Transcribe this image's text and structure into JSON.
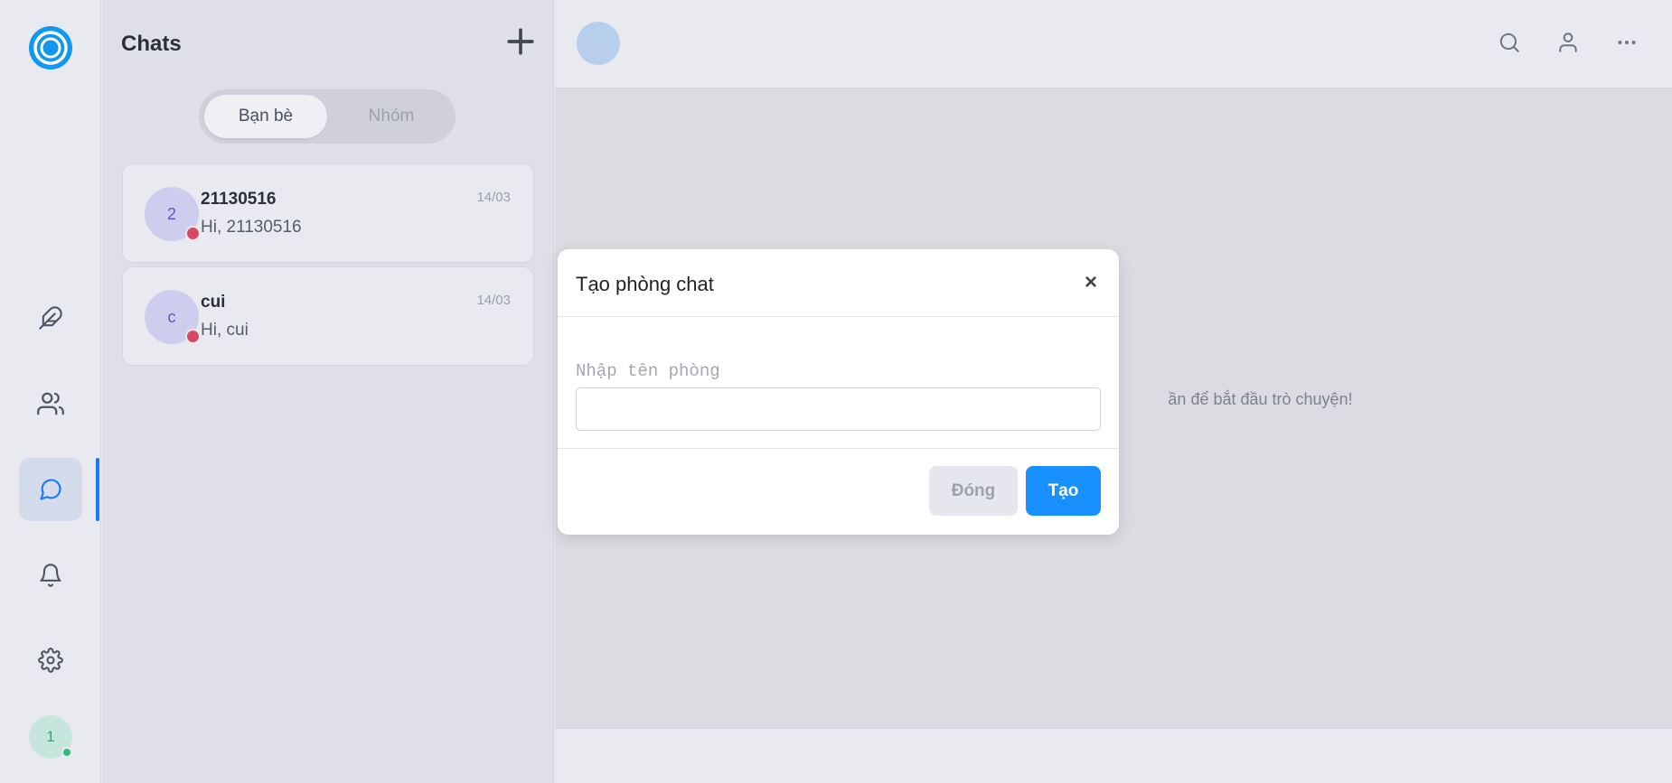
{
  "rail": {
    "avatar_initial": "1",
    "accent": "#1677ff"
  },
  "panel": {
    "title": "Chats",
    "tabs": [
      {
        "label": "Bạn bè",
        "active": true
      },
      {
        "label": "Nhóm",
        "active": false
      }
    ],
    "conversations": [
      {
        "initial": "2",
        "name": "21130516",
        "last_message": "Hi, 21130516",
        "time": "14/03"
      },
      {
        "initial": "c",
        "name": "cui",
        "last_message": "Hi, cui",
        "time": "14/03"
      }
    ]
  },
  "main": {
    "empty_text": "ần để bắt đầu trò chuyện!"
  },
  "modal": {
    "title": "Tạo phòng chat",
    "close_symbol": "×",
    "field_label": "Nhập tên phòng",
    "field_value": "",
    "cancel_label": "Đóng",
    "create_label": "Tạo"
  }
}
